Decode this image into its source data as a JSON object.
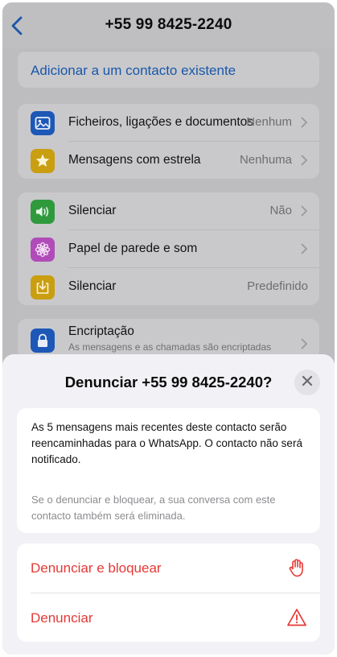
{
  "nav": {
    "title": "+55 99 8425-2240"
  },
  "top_card": {
    "link": "Adicionar a um contacto existente"
  },
  "media_card": {
    "rows": [
      {
        "label": "Ficheiros, ligações e documentos",
        "value": "Nenhum",
        "icon": "photo-icon"
      },
      {
        "label": "Mensagens com estrela",
        "value": "Nenhuma",
        "icon": "star-icon"
      }
    ]
  },
  "settings_card": {
    "rows": [
      {
        "label": "Silenciar",
        "value": "Não",
        "icon": "speaker-icon"
      },
      {
        "label": "Papel de parede e som",
        "value": "",
        "icon": "flower-icon"
      },
      {
        "label": "Silenciar",
        "value": "Predefinido",
        "icon": "save-to-device-icon"
      }
    ]
  },
  "encryption": {
    "title": "Encriptação",
    "subtitle": "As mensagens e as chamadas são encriptadas",
    "icon": "lock-icon"
  },
  "sheet": {
    "title": "Denunciar +55 99 8425-2240?",
    "info_main": "As 5 mensagens mais recentes deste contacto serão reencaminhadas para o WhatsApp. O contacto não será notificado.",
    "info_sub": "Se o denunciar e bloquear, a sua conversa com este contacto também será eliminada.",
    "actions": [
      {
        "label": "Denunciar e bloquear",
        "icon": "hand-stop-icon"
      },
      {
        "label": "Denunciar",
        "icon": "warning-icon"
      }
    ]
  },
  "colors": {
    "accent_blue": "#1a57a8",
    "destructive_red": "#e53935",
    "dim_background": "#bdbdc0",
    "sheet_background": "#f2f2f6"
  }
}
